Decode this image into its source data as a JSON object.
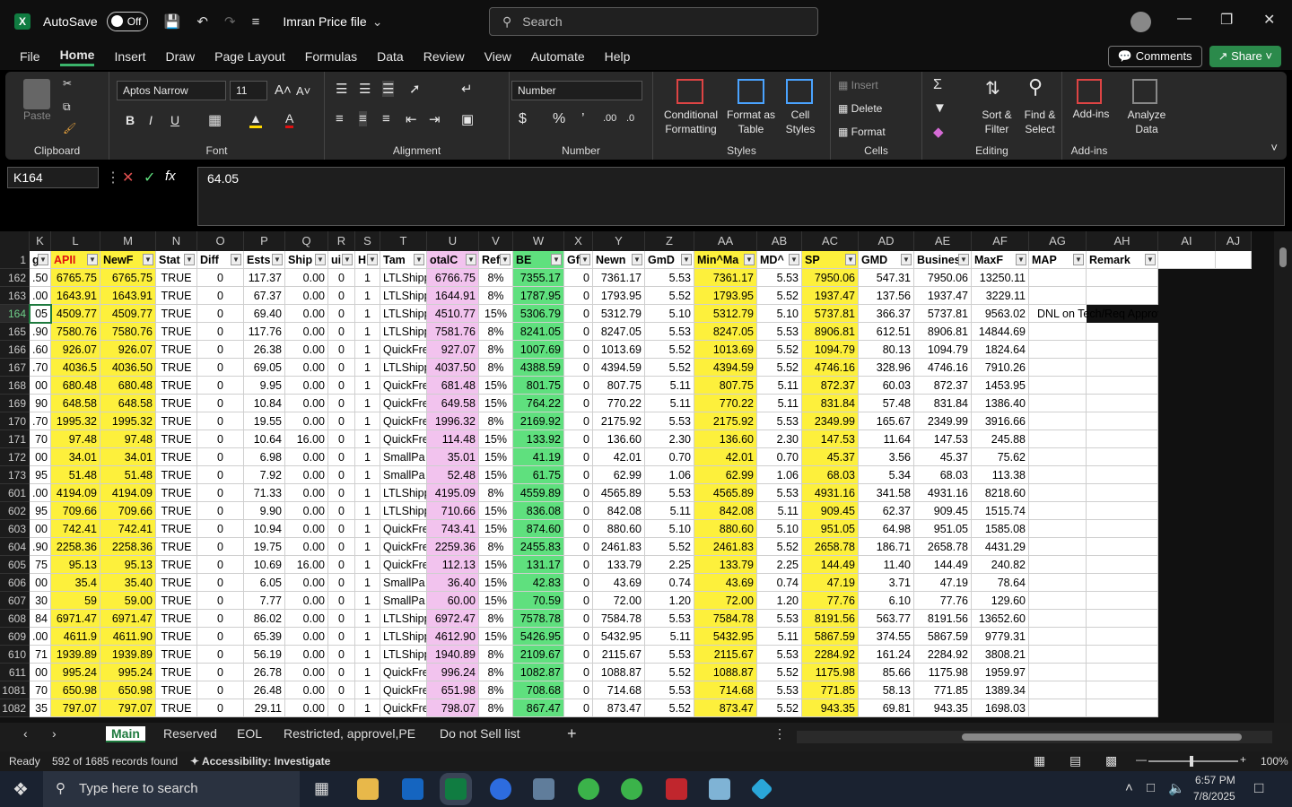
{
  "titlebar": {
    "autosave": "AutoSave",
    "toggle": "Off",
    "filename": "Imran Price file",
    "search_placeholder": "Search"
  },
  "menu": [
    "File",
    "Home",
    "Insert",
    "Draw",
    "Page Layout",
    "Formulas",
    "Data",
    "Review",
    "View",
    "Automate",
    "Help"
  ],
  "menu_active": "Home",
  "actions": {
    "comments": "Comments",
    "share": "Share"
  },
  "ribbon": {
    "clipboard": {
      "label": "Clipboard",
      "paste": "Paste"
    },
    "font": {
      "label": "Font",
      "name": "Aptos Narrow",
      "size": "11"
    },
    "alignment": {
      "label": "Alignment"
    },
    "number": {
      "label": "Number",
      "format": "Number"
    },
    "styles": {
      "label": "Styles",
      "conditional": "Conditional Formatting",
      "format_table": "Format as Table",
      "cell_styles": "Cell Styles"
    },
    "cells": {
      "label": "Cells",
      "insert": "Insert",
      "delete": "Delete",
      "format": "Format"
    },
    "editing": {
      "label": "Editing",
      "sort": "Sort & Filter",
      "find": "Find & Select"
    },
    "addins": {
      "label": "Add-ins",
      "addins": "Add-ins",
      "analyze": "Analyze Data"
    }
  },
  "formula": {
    "namebox": "K164",
    "value": "64.05",
    "fx": "fx"
  },
  "columns": [
    {
      "letter": "K",
      "header": "g"
    },
    {
      "letter": "L",
      "header": "APII"
    },
    {
      "letter": "M",
      "header": "NewF"
    },
    {
      "letter": "N",
      "header": "Stat"
    },
    {
      "letter": "O",
      "header": "Diff"
    },
    {
      "letter": "P",
      "header": "Ests"
    },
    {
      "letter": "Q",
      "header": "Ship"
    },
    {
      "letter": "R",
      "header": "ui"
    },
    {
      "letter": "S",
      "header": "H"
    },
    {
      "letter": "T",
      "header": "Tam"
    },
    {
      "letter": "U",
      "header": "otalC"
    },
    {
      "letter": "V",
      "header": "Ref"
    },
    {
      "letter": "W",
      "header": "BE"
    },
    {
      "letter": "X",
      "header": "Gf"
    },
    {
      "letter": "Y",
      "header": "Newn"
    },
    {
      "letter": "Z",
      "header": "GmD"
    },
    {
      "letter": "AA",
      "header": "Min^Ma"
    },
    {
      "letter": "AB",
      "header": "MD^"
    },
    {
      "letter": "AC",
      "header": "SP"
    },
    {
      "letter": "AD",
      "header": "GMD"
    },
    {
      "letter": "AE",
      "header": "Busines"
    },
    {
      "letter": "AF",
      "header": "MaxF"
    },
    {
      "letter": "AG",
      "header": "MAP"
    },
    {
      "letter": "AH",
      "header": "Remark"
    },
    {
      "letter": "AI",
      "header": ""
    },
    {
      "letter": "AJ",
      "header": ""
    }
  ],
  "rows": [
    {
      "n": "162",
      "c": [
        ".50",
        "6765.75",
        "6765.75",
        "TRUE",
        "0",
        "117.37",
        "0.00",
        "0",
        "1",
        "LTLShipp",
        "6766.75",
        "8%",
        "7355.17",
        "0",
        "7361.17",
        "5.53",
        "7361.17",
        "5.53",
        "7950.06",
        "547.31",
        "7950.06",
        "13250.11",
        "",
        ""
      ]
    },
    {
      "n": "163",
      "c": [
        ".00",
        "1643.91",
        "1643.91",
        "TRUE",
        "0",
        "67.37",
        "0.00",
        "0",
        "1",
        "LTLShipp",
        "1644.91",
        "8%",
        "1787.95",
        "0",
        "1793.95",
        "5.52",
        "1793.95",
        "5.52",
        "1937.47",
        "137.56",
        "1937.47",
        "3229.11",
        "",
        ""
      ]
    },
    {
      "n": "164",
      "c": [
        "05",
        "4509.77",
        "4509.77",
        "TRUE",
        "0",
        "69.40",
        "0.00",
        "0",
        "1",
        "LTLShipp",
        "4510.77",
        "15%",
        "5306.79",
        "0",
        "5312.79",
        "5.10",
        "5312.79",
        "5.10",
        "5737.81",
        "366.37",
        "5737.81",
        "9563.02",
        "",
        "DNL on Tech/Req Approvel"
      ]
    },
    {
      "n": "165",
      "c": [
        ".90",
        "7580.76",
        "7580.76",
        "TRUE",
        "0",
        "117.76",
        "0.00",
        "0",
        "1",
        "LTLShipp",
        "7581.76",
        "8%",
        "8241.05",
        "0",
        "8247.05",
        "5.53",
        "8247.05",
        "5.53",
        "8906.81",
        "612.51",
        "8906.81",
        "14844.69",
        "",
        ""
      ]
    },
    {
      "n": "166",
      "c": [
        ".60",
        "926.07",
        "926.07",
        "TRUE",
        "0",
        "26.38",
        "0.00",
        "0",
        "1",
        "QuickFre",
        "927.07",
        "8%",
        "1007.69",
        "0",
        "1013.69",
        "5.52",
        "1013.69",
        "5.52",
        "1094.79",
        "80.13",
        "1094.79",
        "1824.64",
        "",
        ""
      ]
    },
    {
      "n": "167",
      "c": [
        ".70",
        "4036.5",
        "4036.50",
        "TRUE",
        "0",
        "69.05",
        "0.00",
        "0",
        "1",
        "LTLShipp",
        "4037.50",
        "8%",
        "4388.59",
        "0",
        "4394.59",
        "5.52",
        "4394.59",
        "5.52",
        "4746.16",
        "328.96",
        "4746.16",
        "7910.26",
        "",
        ""
      ]
    },
    {
      "n": "168",
      "c": [
        "00",
        "680.48",
        "680.48",
        "TRUE",
        "0",
        "9.95",
        "0.00",
        "0",
        "1",
        "QuickFre",
        "681.48",
        "15%",
        "801.75",
        "0",
        "807.75",
        "5.11",
        "807.75",
        "5.11",
        "872.37",
        "60.03",
        "872.37",
        "1453.95",
        "",
        ""
      ]
    },
    {
      "n": "169",
      "c": [
        "90",
        "648.58",
        "648.58",
        "TRUE",
        "0",
        "10.84",
        "0.00",
        "0",
        "1",
        "QuickFre",
        "649.58",
        "15%",
        "764.22",
        "0",
        "770.22",
        "5.11",
        "770.22",
        "5.11",
        "831.84",
        "57.48",
        "831.84",
        "1386.40",
        "",
        ""
      ]
    },
    {
      "n": "170",
      "c": [
        ".70",
        "1995.32",
        "1995.32",
        "TRUE",
        "0",
        "19.55",
        "0.00",
        "0",
        "1",
        "QuickFre",
        "1996.32",
        "8%",
        "2169.92",
        "0",
        "2175.92",
        "5.53",
        "2175.92",
        "5.53",
        "2349.99",
        "165.67",
        "2349.99",
        "3916.66",
        "",
        ""
      ]
    },
    {
      "n": "171",
      "c": [
        "70",
        "97.48",
        "97.48",
        "TRUE",
        "0",
        "10.64",
        "16.00",
        "0",
        "1",
        "QuickFre",
        "114.48",
        "15%",
        "133.92",
        "0",
        "136.60",
        "2.30",
        "136.60",
        "2.30",
        "147.53",
        "11.64",
        "147.53",
        "245.88",
        "",
        ""
      ]
    },
    {
      "n": "172",
      "c": [
        "00",
        "34.01",
        "34.01",
        "TRUE",
        "0",
        "6.98",
        "0.00",
        "0",
        "1",
        "SmallPa",
        "35.01",
        "15%",
        "41.19",
        "0",
        "42.01",
        "0.70",
        "42.01",
        "0.70",
        "45.37",
        "3.56",
        "45.37",
        "75.62",
        "",
        ""
      ]
    },
    {
      "n": "173",
      "c": [
        "95",
        "51.48",
        "51.48",
        "TRUE",
        "0",
        "7.92",
        "0.00",
        "0",
        "1",
        "SmallPa",
        "52.48",
        "15%",
        "61.75",
        "0",
        "62.99",
        "1.06",
        "62.99",
        "1.06",
        "68.03",
        "5.34",
        "68.03",
        "113.38",
        "",
        ""
      ]
    },
    {
      "n": "601",
      "c": [
        ".00",
        "4194.09",
        "4194.09",
        "TRUE",
        "0",
        "71.33",
        "0.00",
        "0",
        "1",
        "LTLShipp",
        "4195.09",
        "8%",
        "4559.89",
        "0",
        "4565.89",
        "5.53",
        "4565.89",
        "5.53",
        "4931.16",
        "341.58",
        "4931.16",
        "8218.60",
        "",
        ""
      ]
    },
    {
      "n": "602",
      "c": [
        "95",
        "709.66",
        "709.66",
        "TRUE",
        "0",
        "9.90",
        "0.00",
        "0",
        "1",
        "LTLShipp",
        "710.66",
        "15%",
        "836.08",
        "0",
        "842.08",
        "5.11",
        "842.08",
        "5.11",
        "909.45",
        "62.37",
        "909.45",
        "1515.74",
        "",
        ""
      ]
    },
    {
      "n": "603",
      "c": [
        "00",
        "742.41",
        "742.41",
        "TRUE",
        "0",
        "10.94",
        "0.00",
        "0",
        "1",
        "QuickFre",
        "743.41",
        "15%",
        "874.60",
        "0",
        "880.60",
        "5.10",
        "880.60",
        "5.10",
        "951.05",
        "64.98",
        "951.05",
        "1585.08",
        "",
        ""
      ]
    },
    {
      "n": "604",
      "c": [
        ".90",
        "2258.36",
        "2258.36",
        "TRUE",
        "0",
        "19.75",
        "0.00",
        "0",
        "1",
        "QuickFre",
        "2259.36",
        "8%",
        "2455.83",
        "0",
        "2461.83",
        "5.52",
        "2461.83",
        "5.52",
        "2658.78",
        "186.71",
        "2658.78",
        "4431.29",
        "",
        ""
      ]
    },
    {
      "n": "605",
      "c": [
        "75",
        "95.13",
        "95.13",
        "TRUE",
        "0",
        "10.69",
        "16.00",
        "0",
        "1",
        "QuickFre",
        "112.13",
        "15%",
        "131.17",
        "0",
        "133.79",
        "2.25",
        "133.79",
        "2.25",
        "144.49",
        "11.40",
        "144.49",
        "240.82",
        "",
        ""
      ]
    },
    {
      "n": "606",
      "c": [
        "00",
        "35.4",
        "35.40",
        "TRUE",
        "0",
        "6.05",
        "0.00",
        "0",
        "1",
        "SmallPa",
        "36.40",
        "15%",
        "42.83",
        "0",
        "43.69",
        "0.74",
        "43.69",
        "0.74",
        "47.19",
        "3.71",
        "47.19",
        "78.64",
        "",
        ""
      ]
    },
    {
      "n": "607",
      "c": [
        "30",
        "59",
        "59.00",
        "TRUE",
        "0",
        "7.77",
        "0.00",
        "0",
        "1",
        "SmallPa",
        "60.00",
        "15%",
        "70.59",
        "0",
        "72.00",
        "1.20",
        "72.00",
        "1.20",
        "77.76",
        "6.10",
        "77.76",
        "129.60",
        "",
        ""
      ]
    },
    {
      "n": "608",
      "c": [
        "84",
        "6971.47",
        "6971.47",
        "TRUE",
        "0",
        "86.02",
        "0.00",
        "0",
        "1",
        "LTLShipp",
        "6972.47",
        "8%",
        "7578.78",
        "0",
        "7584.78",
        "5.53",
        "7584.78",
        "5.53",
        "8191.56",
        "563.77",
        "8191.56",
        "13652.60",
        "",
        ""
      ]
    },
    {
      "n": "609",
      "c": [
        ".00",
        "4611.9",
        "4611.90",
        "TRUE",
        "0",
        "65.39",
        "0.00",
        "0",
        "1",
        "LTLShipp",
        "4612.90",
        "15%",
        "5426.95",
        "0",
        "5432.95",
        "5.11",
        "5432.95",
        "5.11",
        "5867.59",
        "374.55",
        "5867.59",
        "9779.31",
        "",
        ""
      ]
    },
    {
      "n": "610",
      "c": [
        "71",
        "1939.89",
        "1939.89",
        "TRUE",
        "0",
        "56.19",
        "0.00",
        "0",
        "1",
        "LTLShipp",
        "1940.89",
        "8%",
        "2109.67",
        "0",
        "2115.67",
        "5.53",
        "2115.67",
        "5.53",
        "2284.92",
        "161.24",
        "2284.92",
        "3808.21",
        "",
        ""
      ]
    },
    {
      "n": "611",
      "c": [
        "00",
        "995.24",
        "995.24",
        "TRUE",
        "0",
        "26.78",
        "0.00",
        "0",
        "1",
        "QuickFre",
        "996.24",
        "8%",
        "1082.87",
        "0",
        "1088.87",
        "5.52",
        "1088.87",
        "5.52",
        "1175.98",
        "85.66",
        "1175.98",
        "1959.97",
        "",
        ""
      ]
    },
    {
      "n": "1081",
      "c": [
        "70",
        "650.98",
        "650.98",
        "TRUE",
        "0",
        "26.48",
        "0.00",
        "0",
        "1",
        "QuickFre",
        "651.98",
        "8%",
        "708.68",
        "0",
        "714.68",
        "5.53",
        "714.68",
        "5.53",
        "771.85",
        "58.13",
        "771.85",
        "1389.34",
        "",
        ""
      ]
    },
    {
      "n": "1082",
      "c": [
        "35",
        "797.07",
        "797.07",
        "TRUE",
        "0",
        "29.11",
        "0.00",
        "0",
        "1",
        "QuickFre",
        "798.07",
        "8%",
        "867.47",
        "0",
        "873.47",
        "5.52",
        "873.47",
        "5.52",
        "943.35",
        "69.81",
        "943.35",
        "1698.03",
        "",
        ""
      ]
    }
  ],
  "sheets": [
    "Main",
    "Reserved",
    "EOL",
    "Restricted, approvel,PE",
    "Do not Sell list"
  ],
  "active_sheet": "Main",
  "status": {
    "ready": "Ready",
    "records": "592 of 1685 records found",
    "accessibility": "Accessibility: Investigate",
    "zoom": "100%"
  },
  "taskbar": {
    "search": "Type here to search",
    "time": "6:57 PM",
    "date": "7/8/2025"
  },
  "colors": {
    "yellow": "#fdf03c",
    "pink": "#f2c3ee",
    "green": "#5fe07e",
    "grid_line": "#cfcfcf",
    "excel_green": "#107c41"
  }
}
